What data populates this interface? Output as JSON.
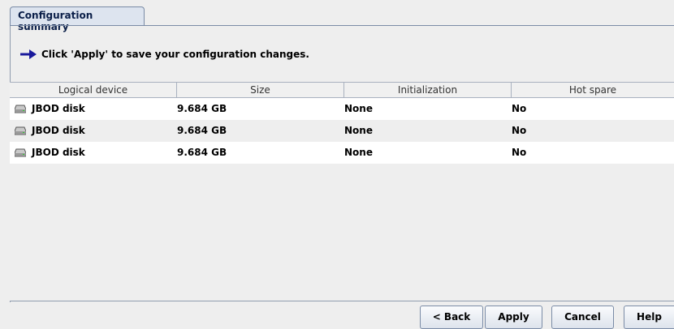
{
  "tab": {
    "label": "Configuration summary"
  },
  "info": {
    "message": "Click 'Apply' to save your configuration changes."
  },
  "table": {
    "headers": [
      "Logical device",
      "Size",
      "Initialization",
      "Hot spare"
    ],
    "rows": [
      {
        "device": "JBOD disk",
        "size": "9.684 GB",
        "initialization": "None",
        "hot_spare": "No"
      },
      {
        "device": "JBOD disk",
        "size": "9.684 GB",
        "initialization": "None",
        "hot_spare": "No"
      },
      {
        "device": "JBOD disk",
        "size": "9.684 GB",
        "initialization": "None",
        "hot_spare": "No"
      }
    ]
  },
  "buttons": {
    "back": "< Back",
    "apply": "Apply",
    "cancel": "Cancel",
    "help": "Help"
  },
  "icons": {
    "info": "arrow-right-icon",
    "row": "disk-icon"
  },
  "colors": {
    "arrow": "#1a1a9c",
    "tab_border": "#7a8ba6",
    "row_alt": "#ffffff"
  }
}
